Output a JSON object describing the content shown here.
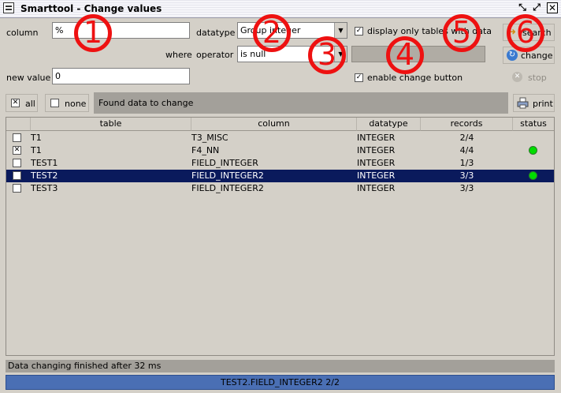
{
  "window": {
    "title": "Smarttool - Change values",
    "minimize_glyph": "⤡",
    "maximize_glyph": "⤢",
    "close_glyph": "✕"
  },
  "form": {
    "column_label": "column",
    "column_value": "%",
    "datatype_label": "datatype",
    "datatype_value": "Group integer",
    "display_only_label": "display only tables with data",
    "display_only_checked": true,
    "where_label": "where",
    "operator_label": "operator",
    "operator_value": "is null",
    "new_value_label": "new value",
    "new_value_value": "0",
    "enable_change_label": "enable change button",
    "enable_change_checked": true
  },
  "buttons": {
    "search": "search",
    "change": "change",
    "stop": "stop",
    "print": "print",
    "all": "all",
    "none": "none"
  },
  "found_label": "Found data to change",
  "table": {
    "headers": [
      "table",
      "column",
      "datatype",
      "records",
      "status"
    ],
    "rows": [
      {
        "checked": false,
        "table": "T1",
        "column": "T3_MISC",
        "datatype": "INTEGER",
        "records": "2/4",
        "status": "none",
        "selected": false
      },
      {
        "checked": true,
        "table": "T1",
        "column": "F4_NN",
        "datatype": "INTEGER",
        "records": "4/4",
        "status": "green",
        "selected": false
      },
      {
        "checked": false,
        "table": "TEST1",
        "column": "FIELD_INTEGER",
        "datatype": "INTEGER",
        "records": "1/3",
        "status": "none",
        "selected": false
      },
      {
        "checked": true,
        "table": "TEST2",
        "column": "FIELD_INTEGER2",
        "datatype": "INTEGER",
        "records": "3/3",
        "status": "green",
        "selected": true
      },
      {
        "checked": false,
        "table": "TEST3",
        "column": "FIELD_INTEGER2",
        "datatype": "INTEGER",
        "records": "3/3",
        "status": "none",
        "selected": false
      }
    ]
  },
  "status_text": "Data changing finished after 32 ms",
  "progress_text": "TEST2.FIELD_INTEGER2 2/2",
  "progress_fraction": 1.0,
  "annotations": [
    "1",
    "2",
    "3",
    "4",
    "5",
    "6"
  ],
  "colors": {
    "selection": "#0a1a5c",
    "status_ok": "#00dd00",
    "progress": "#4a6fb4",
    "annotation": "#ee1111"
  },
  "icons": {
    "app": "app-menu-icon",
    "search": "search-arrow-icon",
    "change": "change-cycle-icon",
    "stop": "stop-icon",
    "print": "printer-icon"
  }
}
